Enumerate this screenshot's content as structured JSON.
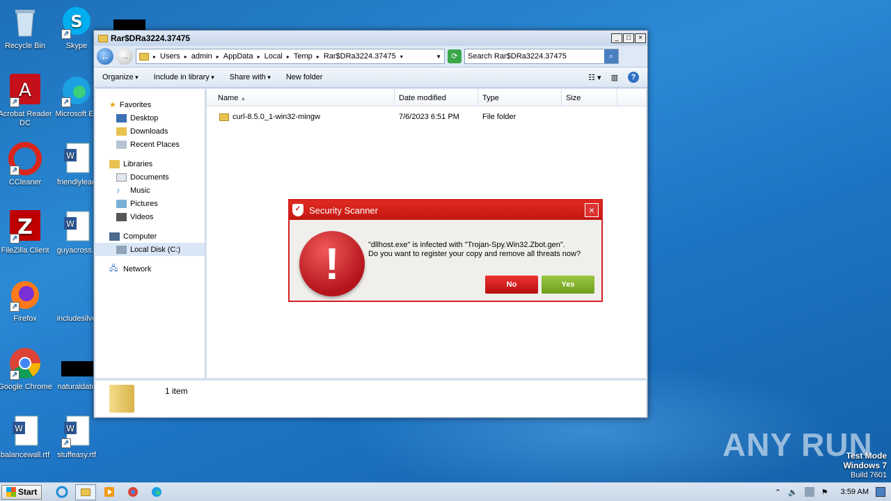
{
  "desktop": {
    "icons": [
      {
        "label": "Recycle Bin",
        "icon": "recycle-bin-icon"
      },
      {
        "label": "Skype",
        "icon": "skype-icon"
      },
      {
        "label": "Acrobat Reader DC",
        "icon": "acrobat-icon"
      },
      {
        "label": "Microsoft Ed",
        "icon": "edge-icon"
      },
      {
        "label": "CCleaner",
        "icon": "ccleaner-icon"
      },
      {
        "label": "friendlylead",
        "icon": "word-doc-icon"
      },
      {
        "label": "FileZilla Client",
        "icon": "filezilla-icon"
      },
      {
        "label": "guyacross.r",
        "icon": "word-doc-icon"
      },
      {
        "label": "Firefox",
        "icon": "firefox-icon"
      },
      {
        "label": "includesilve",
        "icon": "file-icon"
      },
      {
        "label": "Google Chrome",
        "icon": "chrome-icon"
      },
      {
        "label": "naturaldate",
        "icon": "file-icon"
      },
      {
        "label": "balancewall.rtf",
        "icon": "word-doc-icon"
      },
      {
        "label": "stuffeasy.rtf",
        "icon": "word-doc-icon"
      }
    ]
  },
  "explorer": {
    "title": "Rar$DRa3224.37475",
    "breadcrumbs": [
      "Users",
      "admin",
      "AppData",
      "Local",
      "Temp",
      "Rar$DRa3224.37475"
    ],
    "search_placeholder": "Search Rar$DRa3224.37475",
    "toolbar": {
      "organize": "Organize",
      "include": "Include in library",
      "share": "Share with",
      "newfolder": "New folder"
    },
    "nav": {
      "favorites": "Favorites",
      "desktop": "Desktop",
      "downloads": "Downloads",
      "recent": "Recent Places",
      "libraries": "Libraries",
      "documents": "Documents",
      "music": "Music",
      "pictures": "Pictures",
      "videos": "Videos",
      "computer": "Computer",
      "localdisk": "Local Disk (C:)",
      "network": "Network"
    },
    "columns": {
      "name": "Name",
      "date": "Date modified",
      "type": "Type",
      "size": "Size"
    },
    "files": [
      {
        "name": "curl-8.5.0_1-win32-mingw",
        "date": "7/6/2023 6:51 PM",
        "type": "File folder",
        "size": ""
      }
    ],
    "status": "1 item"
  },
  "dialog": {
    "title": "Security Scanner",
    "line1": "\"dllhost.exe\" is infected with \"Trojan-Spy.Win32.Zbot.gen\".",
    "line2": "Do you want to register your copy and remove all threats now?",
    "no": "No",
    "yes": "Yes",
    "accent": "#d42020"
  },
  "taskbar": {
    "start": "Start",
    "time": "3:59 AM"
  },
  "watermark": "ANY RUN",
  "testmode": {
    "l1": "Test Mode",
    "l2": "Windows 7",
    "l3": "Build 7601"
  }
}
